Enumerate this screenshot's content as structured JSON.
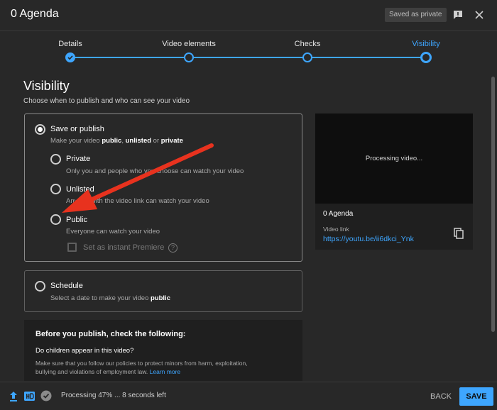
{
  "header": {
    "title": "0 Agenda",
    "saved_badge": "Saved as private"
  },
  "stepper": {
    "steps": [
      {
        "label": "Details",
        "state": "done"
      },
      {
        "label": "Video elements",
        "state": "done"
      },
      {
        "label": "Checks",
        "state": "done"
      },
      {
        "label": "Visibility",
        "state": "current"
      }
    ]
  },
  "visibility": {
    "title": "Visibility",
    "subtitle": "Choose when to publish and who can see your video",
    "save_or_publish": {
      "label": "Save or publish",
      "desc_prefix": "Make your video ",
      "desc_public": "public",
      "desc_sep": ", ",
      "desc_unlisted": "unlisted",
      "desc_or": " or ",
      "desc_private": "private",
      "selected": true
    },
    "options": [
      {
        "label": "Private",
        "desc": "Only you and people who you choose can watch your video"
      },
      {
        "label": "Unlisted",
        "desc": "Anyone with the video link can watch your video"
      },
      {
        "label": "Public",
        "desc": "Everyone can watch your video"
      }
    ],
    "premiere_label": "Set as instant Premiere",
    "schedule": {
      "label": "Schedule",
      "desc_prefix": "Select a date to make your video ",
      "desc_bold": "public"
    }
  },
  "preview": {
    "processing": "Processing video...",
    "title": "0 Agenda",
    "link_label": "Video link",
    "link": "https://youtu.be/ii6dkci_Ynk"
  },
  "before_publish": {
    "title": "Before you publish, check the following:",
    "question": "Do children appear in this video?",
    "body": "Make sure that you follow our policies to protect minors from harm, exploitation, bullying and violations of employment law. ",
    "learn_more": "Learn more"
  },
  "footer": {
    "status": "Processing 47% ... 8 seconds left",
    "back": "BACK",
    "save": "SAVE"
  },
  "colors": {
    "accent": "#3ea6ff",
    "annotation_arrow": "#e8321e",
    "background": "#282828"
  }
}
